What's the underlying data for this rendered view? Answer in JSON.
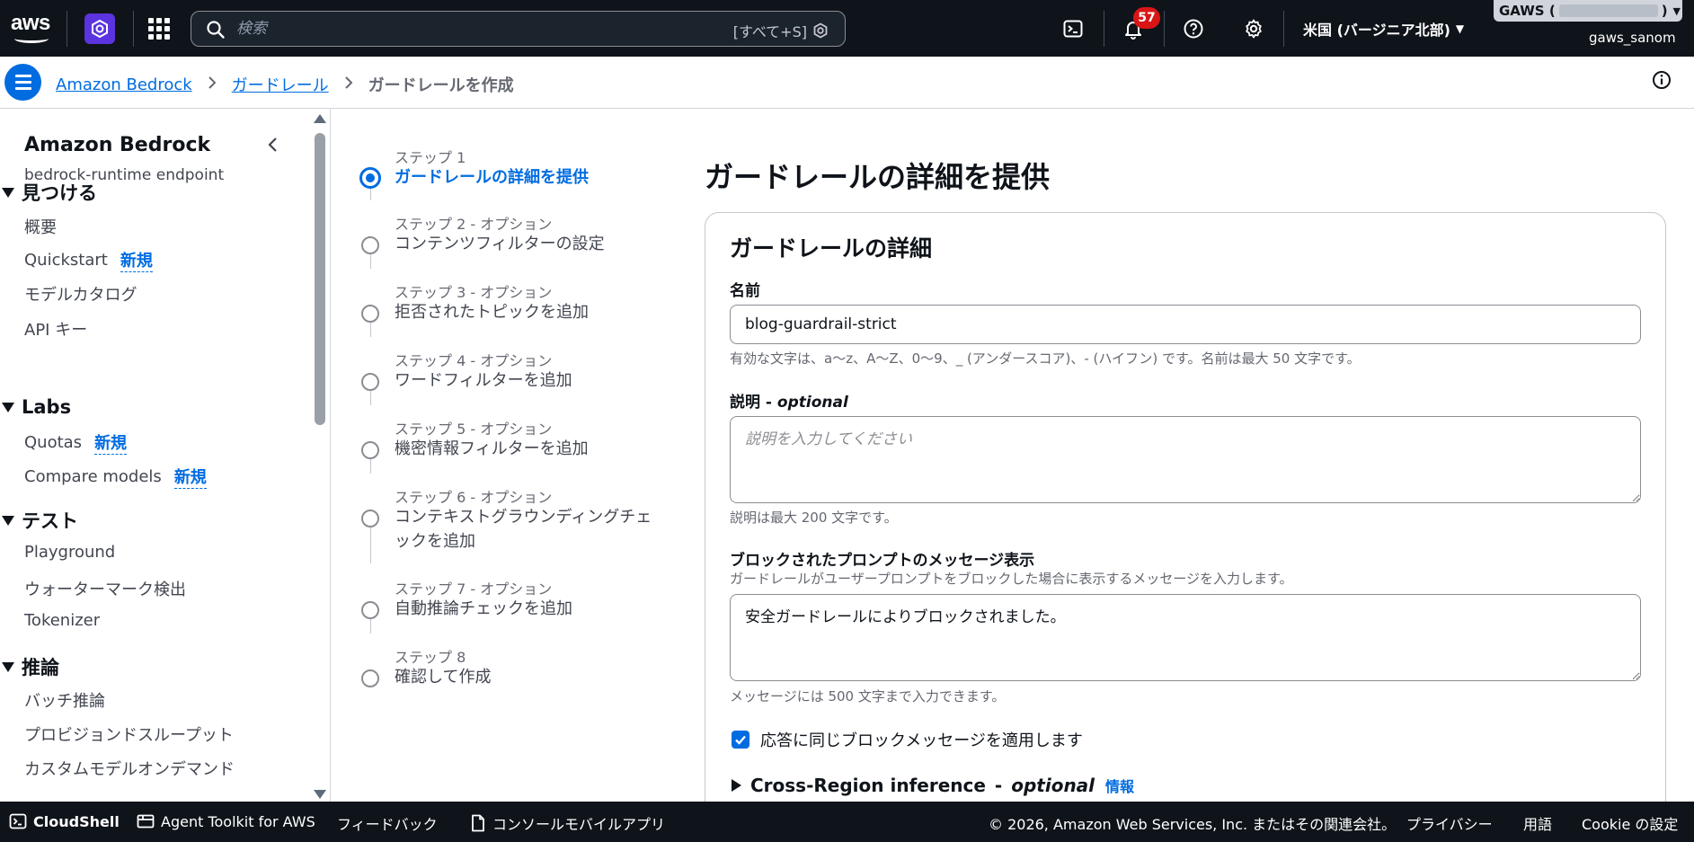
{
  "topnav": {
    "logo_text": "aws",
    "search_placeholder": "検索",
    "search_hint": "[すべて+S]",
    "notification_count": "57",
    "region": "米国 (バージニア北部)",
    "account_prefix": "GAWS (",
    "account_suffix": ")",
    "username": "gaws_sanom"
  },
  "breadcrumbs": {
    "items": [
      "Amazon Bedrock",
      "ガードレール"
    ],
    "current": "ガードレールを作成"
  },
  "sidebar": {
    "title": "Amazon Bedrock",
    "subtitle": "bedrock-runtime endpoint",
    "new_label": "新規",
    "sections": [
      {
        "title": "見つける",
        "items": [
          "概要",
          "Quickstart",
          "モデルカタログ",
          "API キー"
        ]
      },
      {
        "title": "Labs",
        "items": [
          "Quotas",
          "Compare models"
        ]
      },
      {
        "title": "テスト",
        "items": [
          "Playground",
          "ウォーターマーク検出",
          "Tokenizer"
        ]
      },
      {
        "title": "推論",
        "items": [
          "バッチ推論",
          "プロビジョンドスループット",
          "カスタムモデルオンデマンド"
        ]
      }
    ]
  },
  "steps": [
    {
      "label": "ステップ 1",
      "name": "ガードレールの詳細を提供"
    },
    {
      "label": "ステップ 2 - オプション",
      "name": "コンテンツフィルターの設定"
    },
    {
      "label": "ステップ 3 - オプション",
      "name": "拒否されたトピックを追加"
    },
    {
      "label": "ステップ 4 - オプション",
      "name": "ワードフィルターを追加"
    },
    {
      "label": "ステップ 5 - オプション",
      "name": "機密情報フィルターを追加"
    },
    {
      "label": "ステップ 6 - オプション",
      "name": "コンテキストグラウンディングチェックを追加"
    },
    {
      "label": "ステップ 7 - オプション",
      "name": "自動推論チェックを追加"
    },
    {
      "label": "ステップ 8",
      "name": "確認して作成"
    }
  ],
  "main": {
    "page_title": "ガードレールの詳細を提供",
    "card_title": "ガードレールの詳細",
    "name_label": "名前",
    "name_value": "blog-guardrail-strict",
    "name_hint": "有効な文字は、a〜z、A〜Z、0〜9、_ (アンダースコア)、- (ハイフン) です。名前は最大 50 文字です。",
    "desc_label": "説明",
    "optional": "optional",
    "desc_placeholder": "説明を入力してください",
    "desc_hint": "説明は最大 200 文字です。",
    "blocked_label": "ブロックされたプロンプトのメッセージ表示",
    "blocked_desc": "ガードレールがユーザープロンプトをブロックした場合に表示するメッセージを入力します。",
    "blocked_value": "安全ガードレールによりブロックされました。",
    "blocked_hint": "メッセージには 500 文字まで入力できます。",
    "apply_same_label": "応答に同じブロックメッセージを適用します",
    "apply_same_checked": true,
    "cross_region_label": "Cross-Region inference",
    "info_link": "情報"
  },
  "footer": {
    "cloudshell": "CloudShell",
    "agent_toolkit": "Agent Toolkit for AWS",
    "feedback": "フィードバック",
    "mobile_app": "コンソールモバイルアプリ",
    "copyright": "© 2026, Amazon Web Services, Inc. またはその関連会社。",
    "privacy": "プライバシー",
    "terms": "用語",
    "cookie": "Cookie の設定"
  },
  "colors": {
    "nav_bg": "#0f141a",
    "accent": "#006ce0",
    "badge": "#d91515"
  }
}
